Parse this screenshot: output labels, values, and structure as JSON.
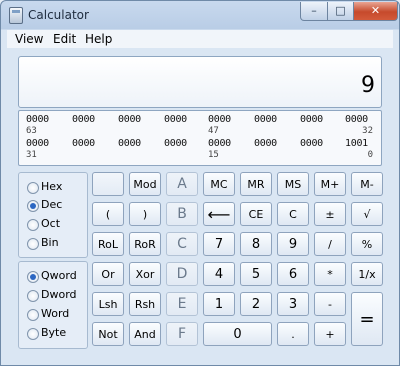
{
  "window": {
    "title": "Calculator",
    "minimize": "–",
    "maximize": "□",
    "close": "✕"
  },
  "menu": [
    "View",
    "Edit",
    "Help"
  ],
  "display": {
    "value": "9"
  },
  "bits": {
    "row1": [
      "0000",
      "0000",
      "0000",
      "0000",
      "0000",
      "0000",
      "0000",
      "0000"
    ],
    "row1_positions": [
      "63",
      "47",
      "32"
    ],
    "row2": [
      "0000",
      "0000",
      "0000",
      "0000",
      "0000",
      "0000",
      "0000",
      "1001"
    ],
    "row2_positions": [
      "31",
      "15",
      "0"
    ]
  },
  "radix": [
    {
      "label": "Hex",
      "selected": false
    },
    {
      "label": "Dec",
      "selected": true
    },
    {
      "label": "Oct",
      "selected": false
    },
    {
      "label": "Bin",
      "selected": false
    }
  ],
  "wordsize": [
    {
      "label": "Qword",
      "selected": true
    },
    {
      "label": "Dword",
      "selected": false
    },
    {
      "label": "Word",
      "selected": false
    },
    {
      "label": "Byte",
      "selected": false
    }
  ],
  "keys": {
    "blank": "",
    "mod": "Mod",
    "a": "A",
    "mc": "MC",
    "mr": "MR",
    "ms": "MS",
    "mplus": "M+",
    "mminus": "M-",
    "lparen": "(",
    "rparen": ")",
    "b": "B",
    "backspace": "⟵",
    "ce": "CE",
    "c": "C",
    "plusminus": "±",
    "sqrt": "√",
    "rol": "RoL",
    "ror": "RoR",
    "hex_c": "C",
    "seven": "7",
    "eight": "8",
    "nine": "9",
    "divide": "/",
    "percent": "%",
    "or": "Or",
    "xor": "Xor",
    "d": "D",
    "four": "4",
    "five": "5",
    "six": "6",
    "multiply": "*",
    "reciprocal": "1/x",
    "lsh": "Lsh",
    "rsh": "Rsh",
    "e": "E",
    "one": "1",
    "two": "2",
    "three": "3",
    "minus": "-",
    "equals": "=",
    "not": "Not",
    "and": "And",
    "f": "F",
    "zero": "0",
    "dot": ".",
    "plus": "+"
  }
}
